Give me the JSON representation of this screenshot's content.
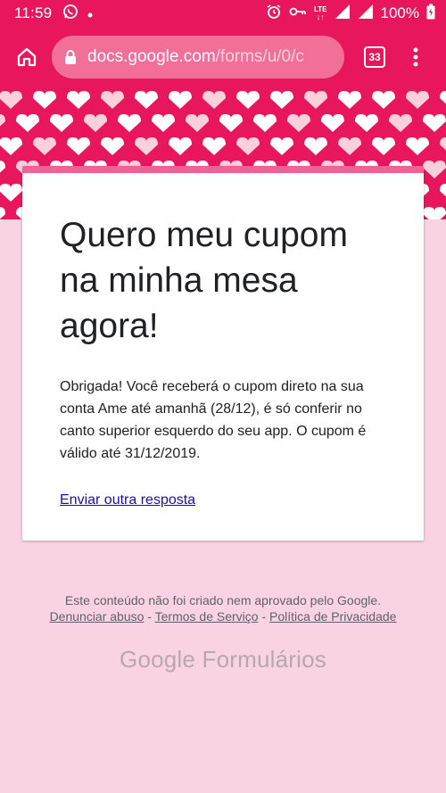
{
  "status_bar": {
    "time": "11:59",
    "network": "LTE",
    "battery": "100%"
  },
  "browser": {
    "url_host": "docs.google.com",
    "url_path": "/forms/u/0/c",
    "tab_count": "33"
  },
  "form": {
    "title": "Quero meu cupom na minha mesa agora!",
    "message": "Obrigada! Você receberá o cupom direto na sua conta Ame até amanhã (28/12), é só conferir no canto superior esquerdo do seu app. O cupom é válido até 31/12/2019.",
    "another_response_link": "Enviar outra resposta"
  },
  "footer": {
    "disclaimer": "Este conteúdo não foi criado nem aprovado pelo Google.",
    "report_abuse": "Denunciar abuso",
    "terms": "Termos de Serviço",
    "privacy": "Política de Privacidade",
    "separator": " - ",
    "brand_google": "Google",
    "brand_product": "Formulários"
  },
  "colors": {
    "brand_pink": "#e8175d",
    "page_background": "#fad3e2",
    "card_accent": "#f06293"
  }
}
